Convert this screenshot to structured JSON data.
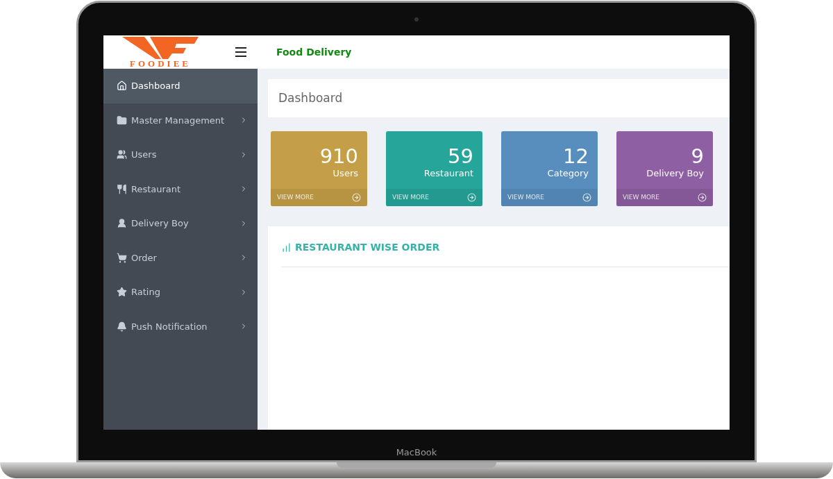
{
  "device": {
    "label": "MacBook"
  },
  "header": {
    "logo_text": "FOODIEE",
    "title": "Food Delivery"
  },
  "sidebar": {
    "items": [
      {
        "label": "Dashboard",
        "kind": "home",
        "selected": true,
        "has_submenu": false
      },
      {
        "label": "Master Management",
        "kind": "folder",
        "selected": false,
        "has_submenu": true
      },
      {
        "label": "Users",
        "kind": "users",
        "selected": false,
        "has_submenu": true
      },
      {
        "label": "Restaurant",
        "kind": "cutlery",
        "selected": false,
        "has_submenu": true
      },
      {
        "label": "Delivery Boy",
        "kind": "person",
        "selected": false,
        "has_submenu": true
      },
      {
        "label": "Order",
        "kind": "cart",
        "selected": false,
        "has_submenu": true
      },
      {
        "label": "Rating",
        "kind": "star",
        "selected": false,
        "has_submenu": true
      },
      {
        "label": "Push Notification",
        "kind": "bell",
        "selected": false,
        "has_submenu": true
      }
    ]
  },
  "page_title": "Dashboard",
  "stat_cards": [
    {
      "value": "910",
      "label": "Users",
      "link": "VIEW MORE",
      "color": "#c49f47"
    },
    {
      "value": "59",
      "label": "Restaurant",
      "link": "VIEW MORE",
      "color": "#26a69a"
    },
    {
      "value": "12",
      "label": "Category",
      "link": "VIEW MORE",
      "color": "#578ebe"
    },
    {
      "value": "9",
      "label": "Delivery Boy",
      "link": "VIEW MORE",
      "color": "#8e5fa2"
    }
  ],
  "chart_panel": {
    "title": "RESTAURANT WISE ORDER"
  }
}
